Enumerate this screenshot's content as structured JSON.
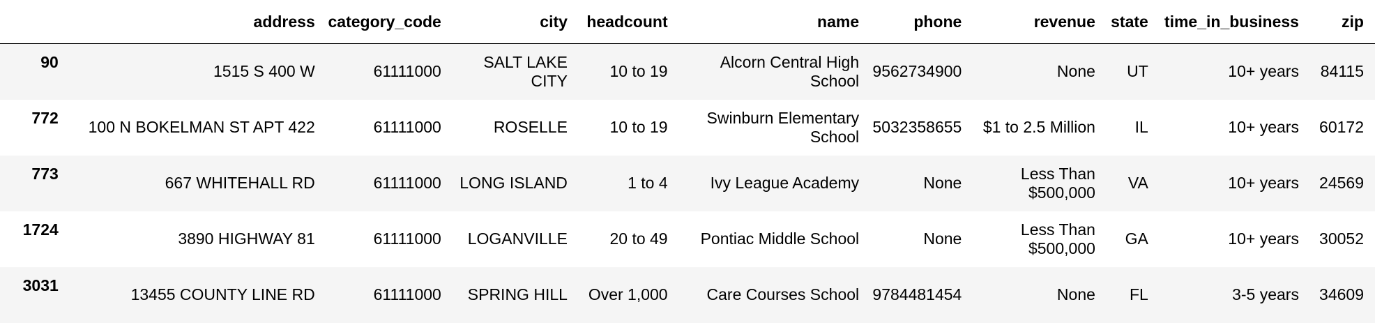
{
  "table": {
    "columns": [
      "",
      "address",
      "category_code",
      "city",
      "headcount",
      "name",
      "phone",
      "revenue",
      "state",
      "time_in_business",
      "zip"
    ],
    "rows": [
      {
        "index": "90",
        "cells": [
          "1515 S 400 W",
          "61111000",
          "SALT LAKE CITY",
          "10 to 19",
          "Alcorn Central High School",
          "9562734900",
          "None",
          "UT",
          "10+ years",
          "84115"
        ]
      },
      {
        "index": "772",
        "cells": [
          "100 N BOKELMAN ST APT 422",
          "61111000",
          "ROSELLE",
          "10 to 19",
          "Swinburn Elementary School",
          "5032358655",
          "$1 to 2.5 Million",
          "IL",
          "10+ years",
          "60172"
        ]
      },
      {
        "index": "773",
        "cells": [
          "667 WHITEHALL RD",
          "61111000",
          "LONG ISLAND",
          "1 to 4",
          "Ivy League Academy",
          "None",
          "Less Than $500,000",
          "VA",
          "10+ years",
          "24569"
        ]
      },
      {
        "index": "1724",
        "cells": [
          "3890 HIGHWAY 81",
          "61111000",
          "LOGANVILLE",
          "20 to 49",
          "Pontiac Middle School",
          "None",
          "Less Than $500,000",
          "GA",
          "10+ years",
          "30052"
        ]
      },
      {
        "index": "3031",
        "cells": [
          "13455 COUNTY LINE RD",
          "61111000",
          "SPRING HILL",
          "Over 1,000",
          "Care Courses School",
          "9784481454",
          "None",
          "FL",
          "3-5 years",
          "34609"
        ]
      }
    ]
  },
  "colors": {
    "row_odd": "#f5f5f5",
    "row_even": "#ffffff",
    "header_rule": "#000000"
  }
}
